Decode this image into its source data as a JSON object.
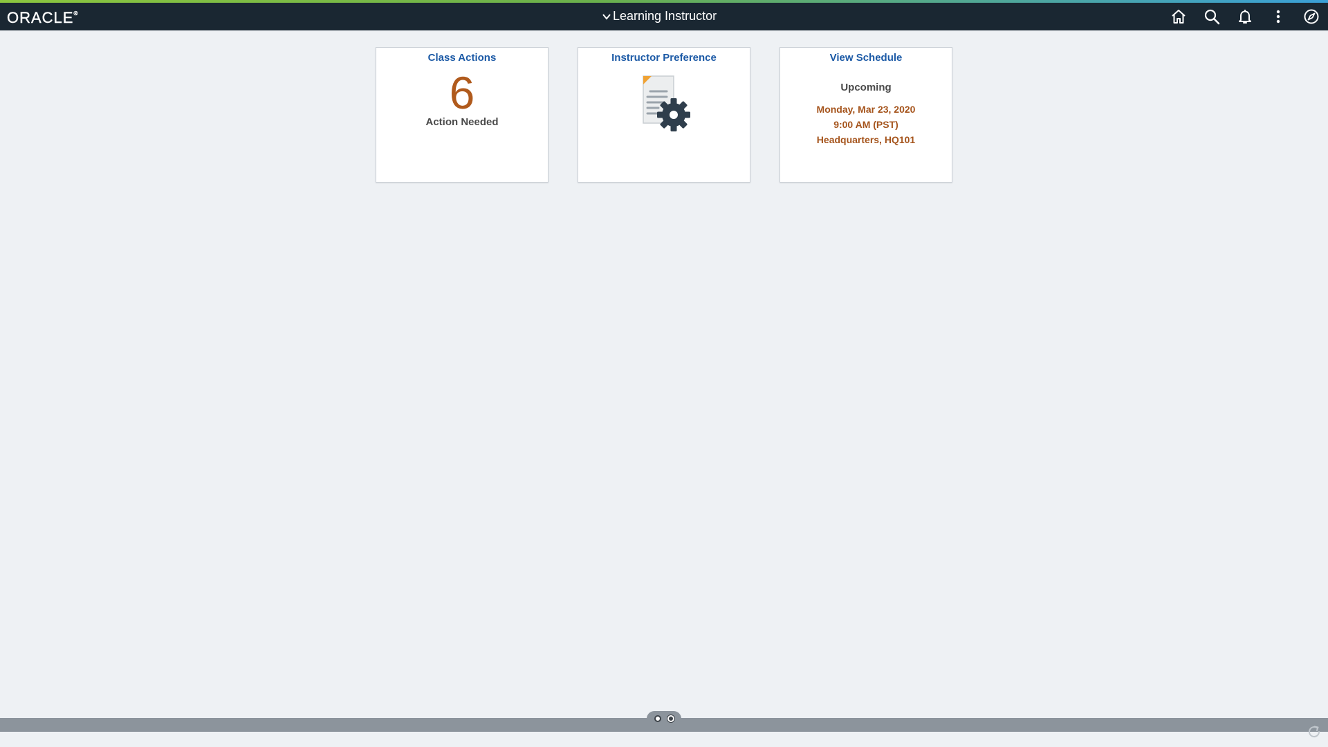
{
  "header": {
    "logo": "ORACLE",
    "logo_mark": "®",
    "title": "Learning Instructor",
    "icons": [
      "home-icon",
      "search-icon",
      "bell-icon",
      "more-vertical-icon",
      "navbar-compass-icon"
    ]
  },
  "tiles": [
    {
      "title": "Class Actions",
      "count": "6",
      "label": "Action Needed"
    },
    {
      "title": "Instructor Preference",
      "icon": "document-gear-icon"
    },
    {
      "title": "View Schedule",
      "subtitle": "Upcoming",
      "lines": [
        "Monday, Mar 23, 2020",
        "9:00 AM (PST)",
        "Headquarters, HQ101"
      ]
    }
  ],
  "footer": {
    "pages": 2,
    "active_page": 2,
    "refresh_icon": "refresh-icon"
  },
  "colors": {
    "header_bg": "#1a2732",
    "tile_title": "#1c5aa6",
    "count": "#b05a1c",
    "schedule_text": "#a5541c",
    "footer_bg": "#8c949c"
  }
}
